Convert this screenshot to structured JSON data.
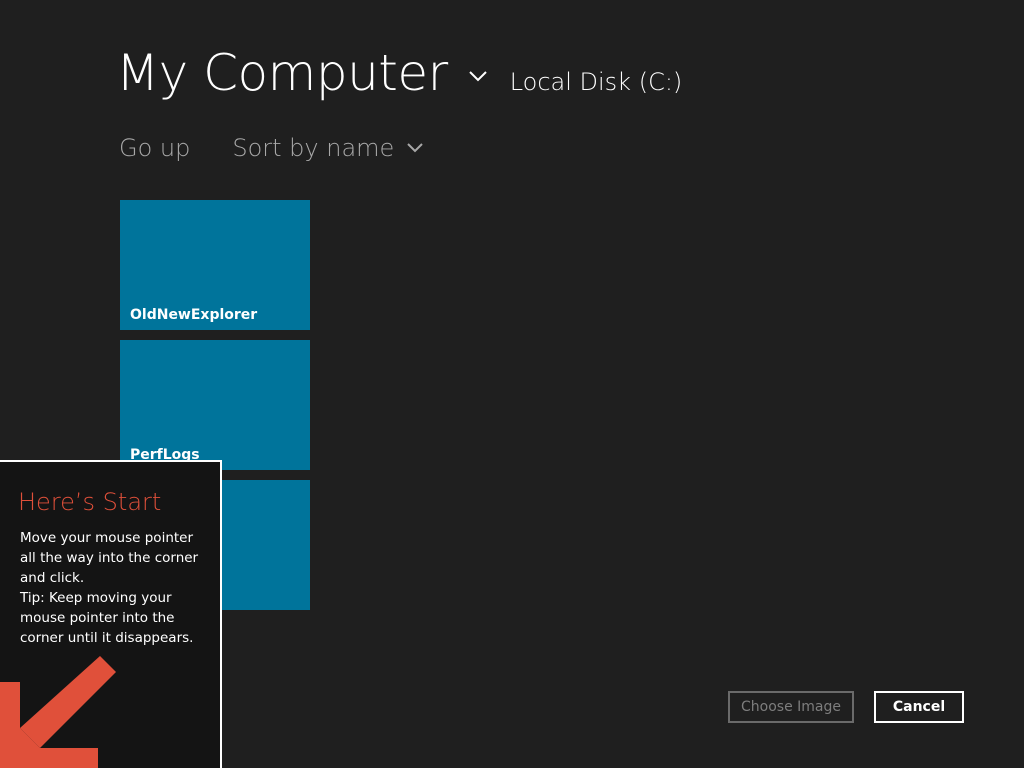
{
  "header": {
    "title": "My Computer",
    "location": "Local Disk (C:)",
    "chevron_icon": "chevron-down-icon"
  },
  "toolbar": {
    "go_up_label": "Go up",
    "sort_label": "Sort by name"
  },
  "tiles": [
    {
      "label": "OldNewExplorer"
    },
    {
      "label": "PerfLogs"
    },
    {
      "label": ""
    }
  ],
  "buttons": {
    "choose_image_label": "Choose Image",
    "cancel_label": "Cancel"
  },
  "start_tip": {
    "title": "Here’s Start",
    "lines": [
      "Move your mouse pointer",
      "all the way into the corner",
      "and click.",
      "Tip: Keep moving your",
      "mouse pointer into the",
      "corner until it disappears."
    ],
    "arrow_icon": "arrow-down-left-icon"
  },
  "colors": {
    "background": "#1f1f1f",
    "tile": "#00749b",
    "tip_title": "#e0503a",
    "tip_arrow": "#e0503a"
  }
}
